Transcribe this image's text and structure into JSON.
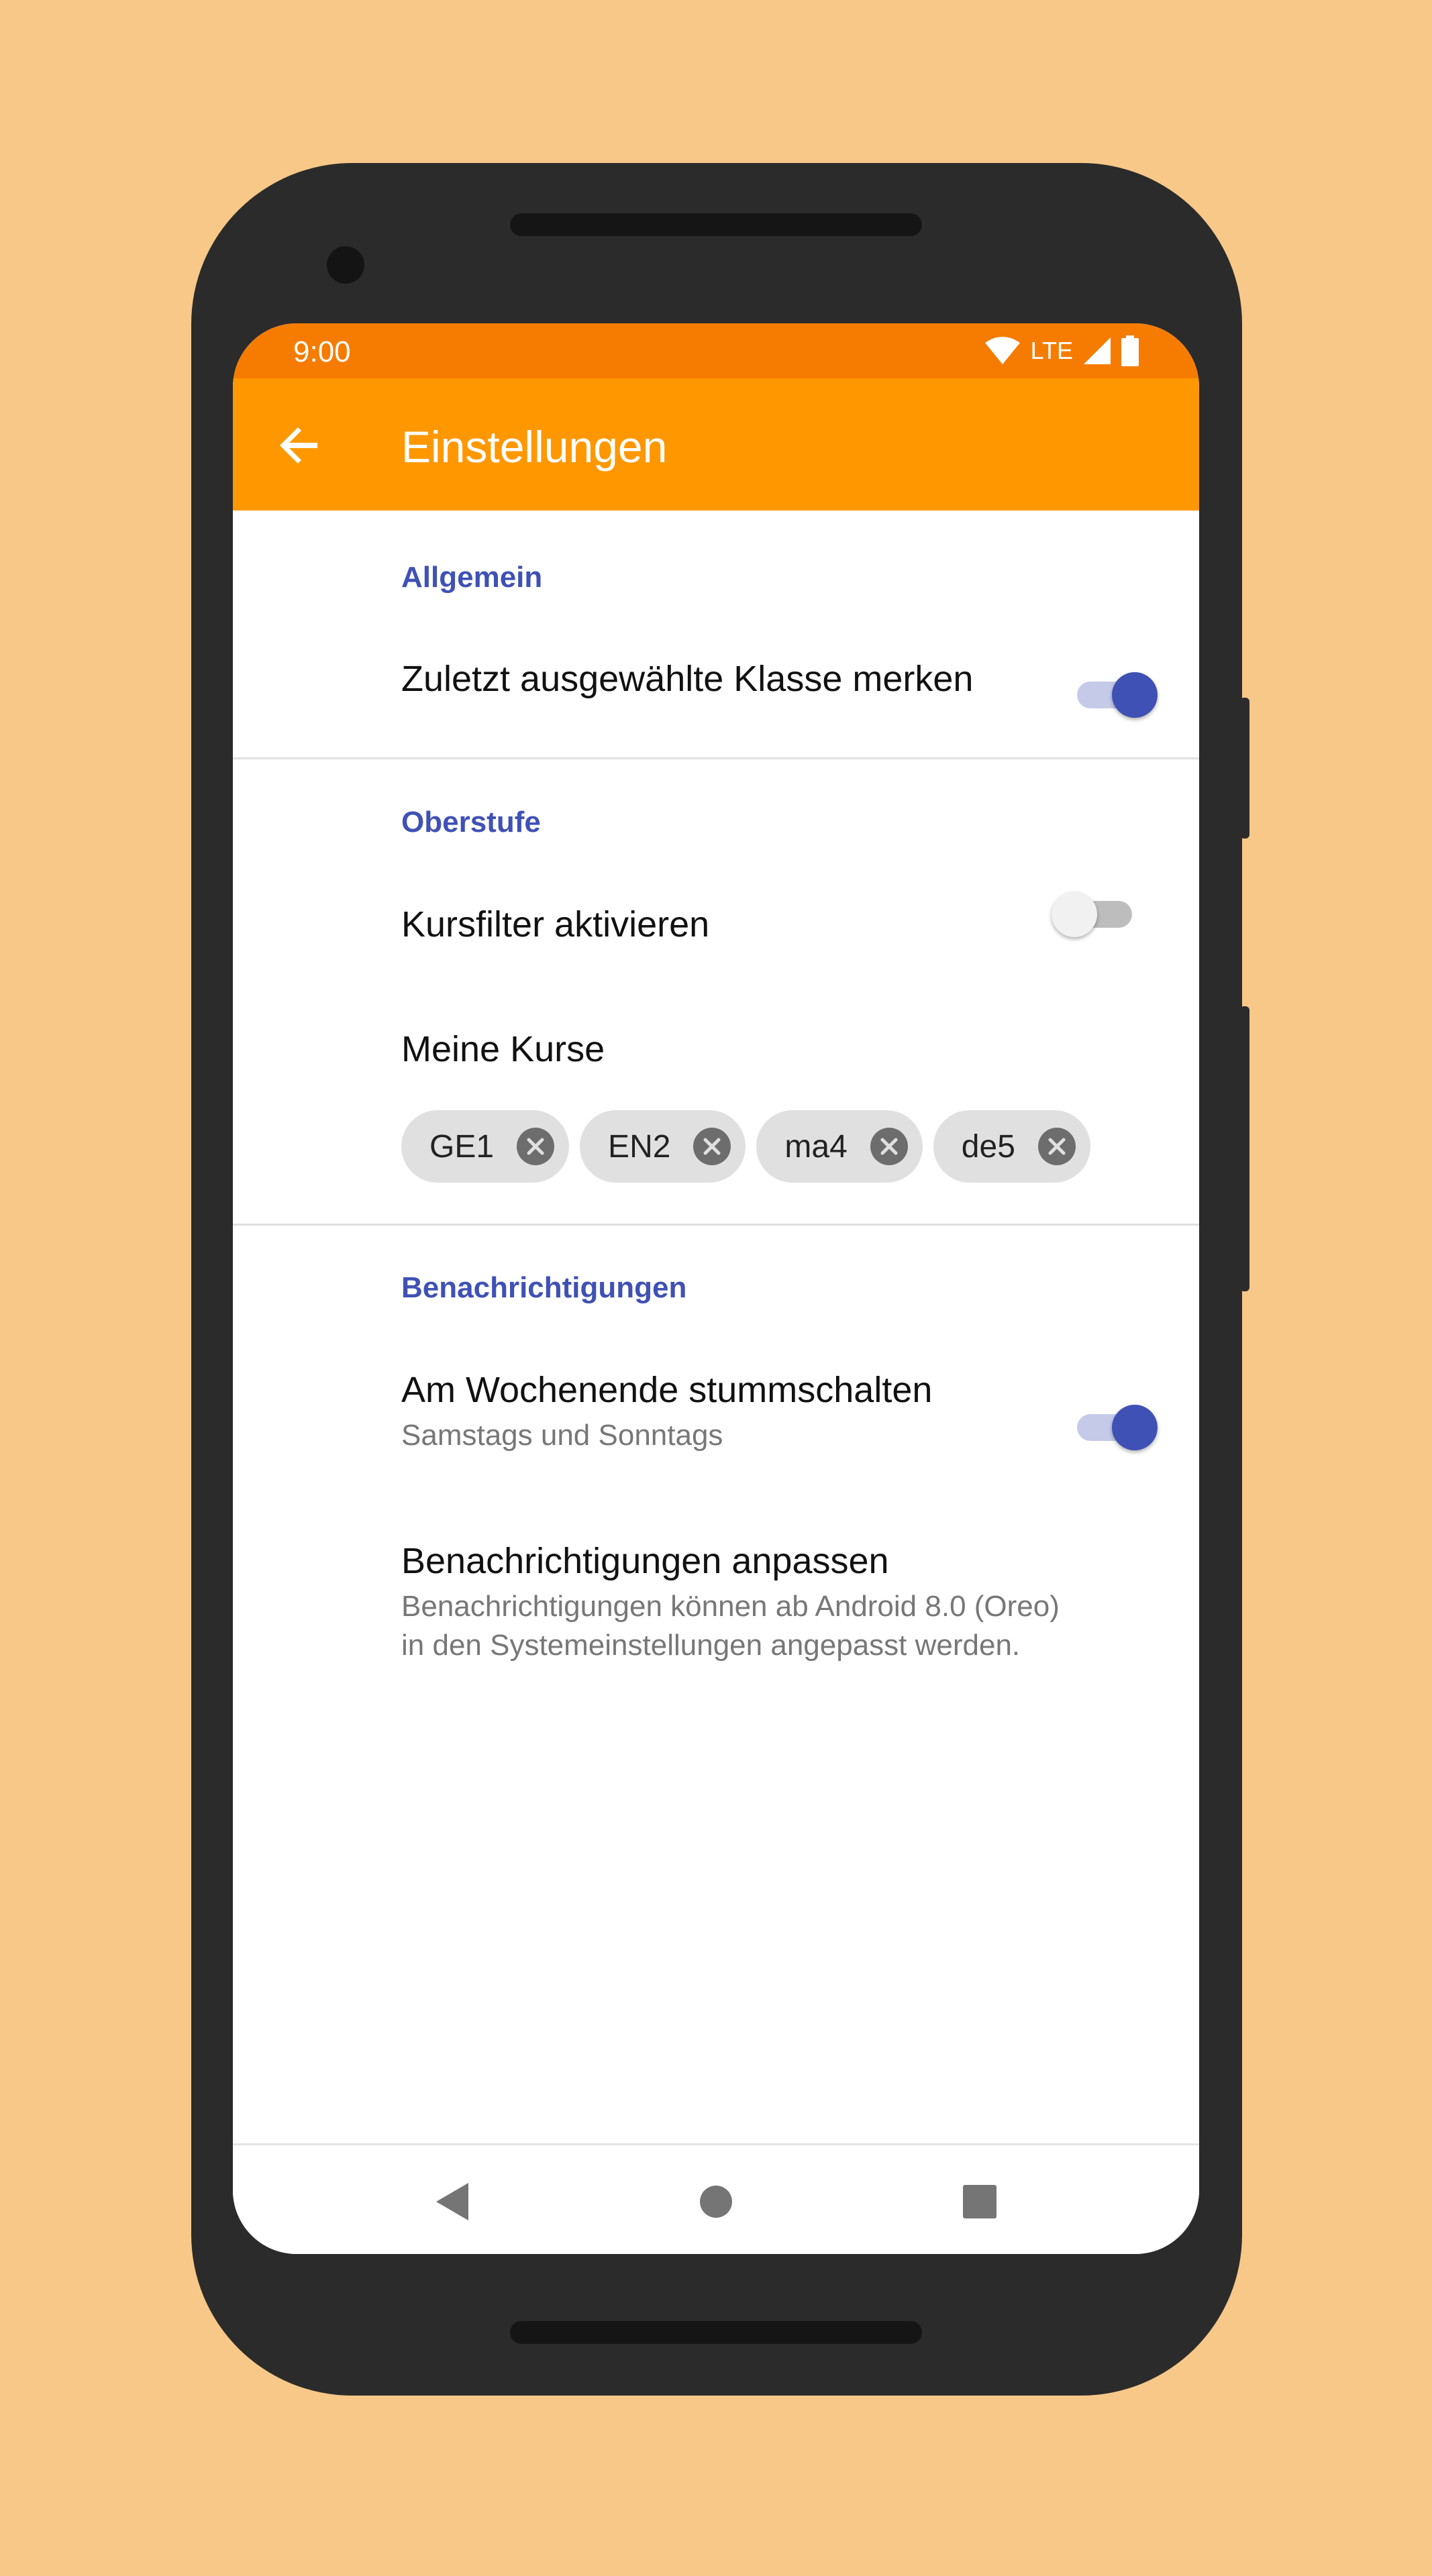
{
  "status_bar": {
    "time": "9:00",
    "network": "LTE",
    "icons": [
      "wifi-icon",
      "signal-icon",
      "battery-icon"
    ]
  },
  "app_bar": {
    "title": "Einstellungen",
    "back_icon": "arrow-back-icon"
  },
  "sections": {
    "general": {
      "header": "Allgemein",
      "remember_class": {
        "title": "Zuletzt ausgewählte Klasse merken",
        "enabled": true
      }
    },
    "upper_school": {
      "header": "Oberstufe",
      "course_filter": {
        "title": "Kursfilter aktivieren",
        "enabled": false
      },
      "my_courses": {
        "title": "Meine Kurse",
        "chips": [
          "GE1",
          "EN2",
          "ma4",
          "de5"
        ]
      }
    },
    "notifications": {
      "header": "Benachrichtigungen",
      "weekend_mute": {
        "title": "Am Wochenende stummschalten",
        "summary": "Samstags und Sonntags",
        "enabled": true
      },
      "customize": {
        "title": "Benachrichtigungen anpassen",
        "summary_line1": "Benachrichtigungen können ab Android 8.0 (Oreo)",
        "summary_line2": "in den Systemeinstellungen angepasst werden."
      }
    }
  },
  "nav_bar": {
    "buttons": [
      "back-triangle-icon",
      "home-circle-icon",
      "recents-square-icon"
    ]
  },
  "colors": {
    "background": "#f7c888",
    "status_bar": "#f57c00",
    "app_bar": "#ff9800",
    "accent": "#3f51b5"
  }
}
